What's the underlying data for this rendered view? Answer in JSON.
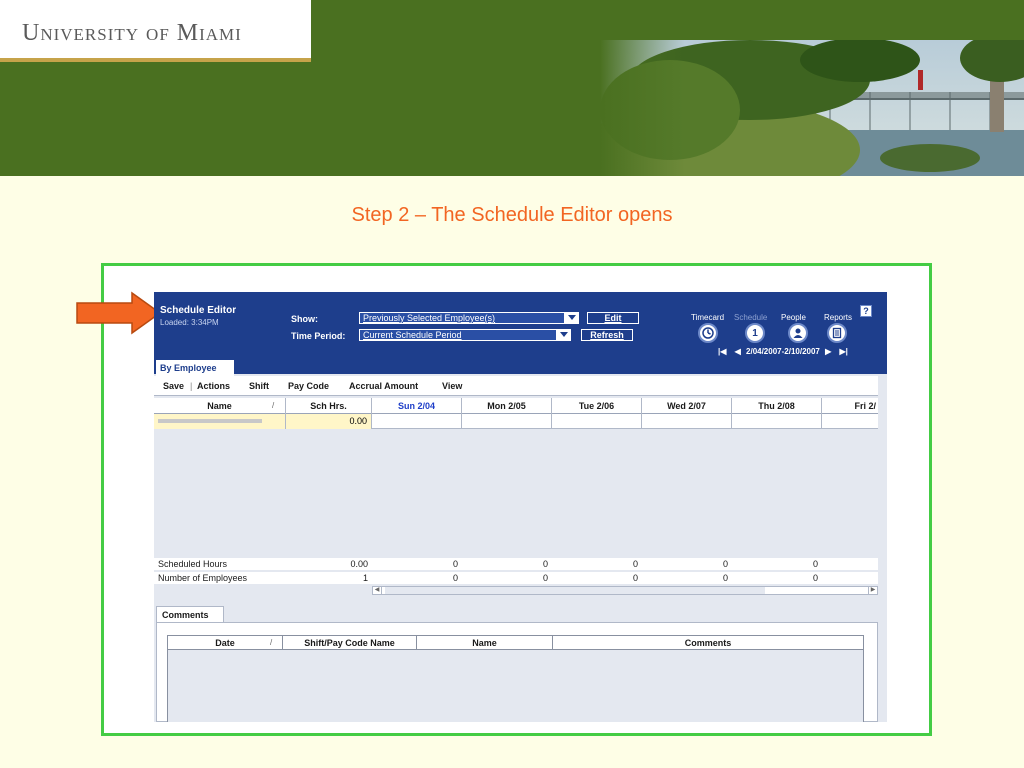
{
  "header": {
    "university_name": "University of Miami"
  },
  "slide": {
    "title": "Step 2 – The Schedule Editor opens"
  },
  "app": {
    "title": "Schedule Editor",
    "loaded": "Loaded: 3:34PM",
    "show_label": "Show:",
    "show_value": "Previously Selected Employee(s)",
    "edit_button": "Edit",
    "period_label": "Time Period:",
    "period_value": "Current Schedule Period",
    "refresh_button": "Refresh",
    "nav": {
      "timecard": "Timecard",
      "schedule": "Schedule",
      "people": "People",
      "reports": "Reports",
      "schedule_icon_text": "1"
    },
    "help_icon_text": "?",
    "period_range": "2/04/2007-2/10/2007"
  },
  "tabs": {
    "by_employee": "By Employee",
    "comments": "Comments"
  },
  "menu": {
    "save": "Save",
    "separator": "|",
    "actions": "Actions",
    "shift": "Shift",
    "pay_code": "Pay Code",
    "accrual_amount": "Accrual Amount",
    "view": "View"
  },
  "grid": {
    "headers": {
      "name": "Name",
      "sort": "/",
      "sch_hrs": "Sch Hrs.",
      "sun": "Sun 2/04",
      "mon": "Mon 2/05",
      "tue": "Tue 2/06",
      "wed": "Wed 2/07",
      "thu": "Thu 2/08",
      "fri": "Fri 2/"
    },
    "row": {
      "sch_hrs": "0.00"
    }
  },
  "totals": {
    "scheduled_hours_label": "Scheduled Hours",
    "scheduled_hours_sch": "0.00",
    "scheduled_hours_days": [
      "0",
      "0",
      "0",
      "0",
      "0"
    ],
    "employees_label": "Number of Employees",
    "employees_sch": "1",
    "employees_days": [
      "0",
      "0",
      "0",
      "0",
      "0"
    ]
  },
  "comments": {
    "headers": {
      "date": "Date",
      "sort": "/",
      "shift_pay_code": "Shift/Pay Code Name",
      "name": "Name",
      "comments": "Comments"
    }
  },
  "colors": {
    "accent": "#F26522",
    "frame": "#44CC44",
    "banner_green": "#4A7020",
    "app_blue": "#1E3E8C"
  }
}
